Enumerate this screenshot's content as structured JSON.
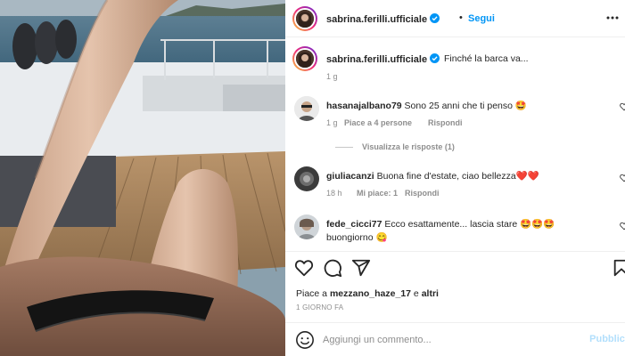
{
  "post": {
    "image_alt": "photo",
    "author": "sabrina.ferilli.ufficiale",
    "verified": true,
    "follow_label": "Segui",
    "more_icon": "more-options-icon"
  },
  "caption": {
    "author": "sabrina.ferilli.ufficiale",
    "text": "Finché la barca va...",
    "time": "1 g"
  },
  "comments": [
    {
      "author": "hasanajalbano79",
      "text": "Sono 25 anni che ti penso 🤩",
      "time": "1 g",
      "likes": "Piace a 4 persone",
      "reply_label": "Rispondi",
      "view_replies": "Visualizza le risposte (1)"
    },
    {
      "author": "giuliacanzi",
      "text": "Buona fine d'estate, ciao bellezza❤️❤️",
      "time": "18 h",
      "likes": "Mi piace: 1",
      "reply_label": "Rispondi"
    },
    {
      "author": "fede_cicci77",
      "text_line1": "Ecco esattamente... lascia stare 🤩🤩🤩",
      "text_line2": "buongiorno 😋"
    }
  ],
  "actions": {
    "like_icon": "heart-icon",
    "comment_icon": "comment-icon",
    "share_icon": "share-icon",
    "save_icon": "bookmark-icon"
  },
  "likes_summary": {
    "prefix": "Piace a ",
    "user": "mezzano_haze_17",
    "middle": " e ",
    "others": "altri"
  },
  "date": "1 GIORNO FA",
  "add_comment": {
    "placeholder": "Aggiungi un commento...",
    "submit_label": "Pubblica",
    "emoji_icon": "emoji-icon"
  }
}
